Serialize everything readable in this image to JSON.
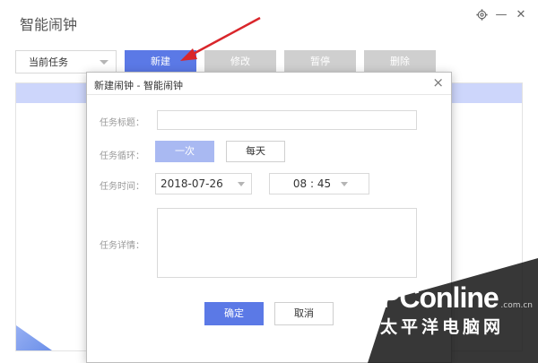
{
  "window": {
    "title": "智能闹钟",
    "settings_icon": "gear-icon",
    "minimize_label": "—",
    "close_label": "✕"
  },
  "toolbar": {
    "task_select_value": "当前任务",
    "new_label": "新建",
    "edit_label": "修改",
    "pause_label": "暂停",
    "delete_label": "删除"
  },
  "dialog": {
    "title": "新建闹钟 - 智能闹钟",
    "close_label": "×",
    "task_title_label": "任务标题：",
    "task_title_value": "",
    "repeat_label": "任务循环：",
    "repeat_options": [
      "一次",
      "每天"
    ],
    "repeat_selected": "一次",
    "time_label": "任务时间：",
    "date_value": "2018-07-26",
    "time_value": "08 : 45",
    "detail_label": "任务详情：",
    "detail_value": "",
    "ok_label": "确定",
    "cancel_label": "取消"
  },
  "watermark": {
    "brand": "PConline",
    "domain": ".com.cn",
    "cn": "太平洋电脑网"
  },
  "colors": {
    "primary": "#5b79e6",
    "selected_segment": "#a9b9f2",
    "disabled": "#cfcfcf",
    "annotation_arrow": "#d9262b"
  }
}
